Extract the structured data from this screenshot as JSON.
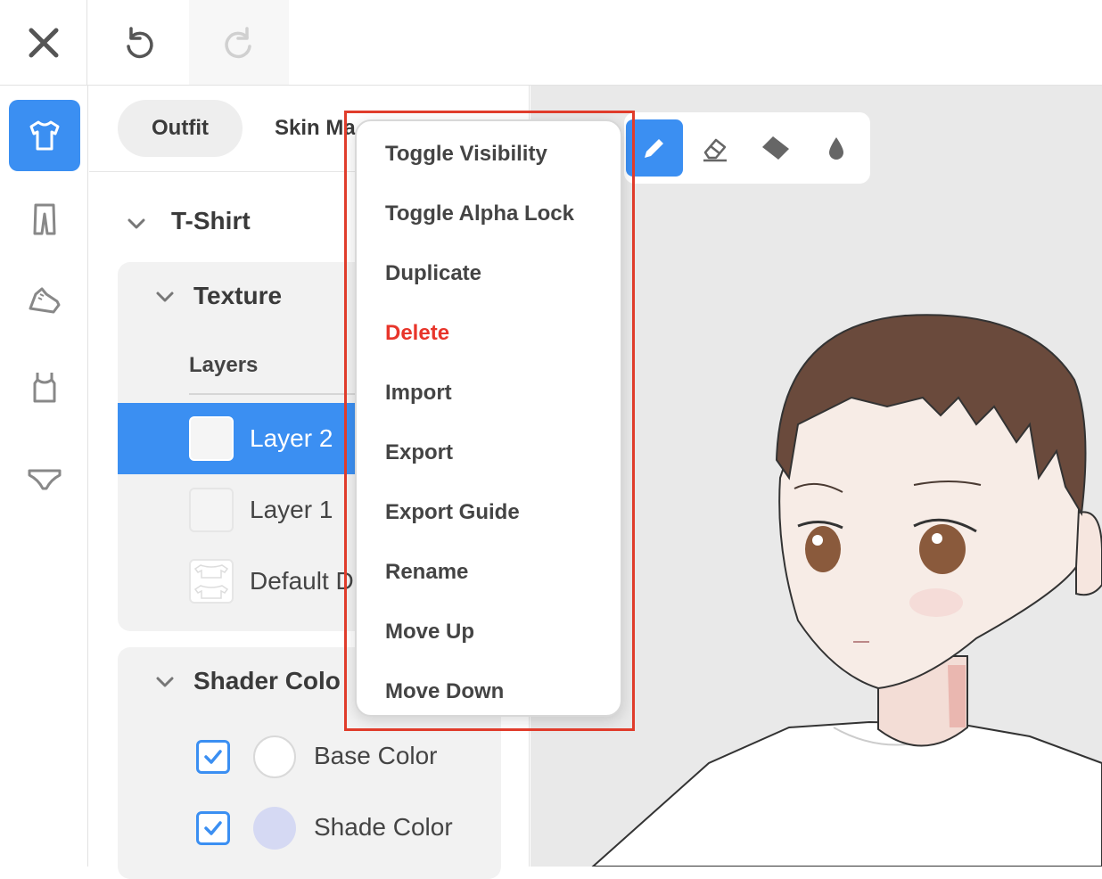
{
  "toolbar": {
    "close_icon": "close-icon",
    "undo_icon": "undo-icon",
    "redo_icon": "redo-icon"
  },
  "sidebar": {
    "items": [
      {
        "icon": "tshirt-icon",
        "active": true
      },
      {
        "icon": "pants-icon",
        "active": false
      },
      {
        "icon": "shoe-icon",
        "active": false
      },
      {
        "icon": "tank-top-icon",
        "active": false
      },
      {
        "icon": "underwear-icon",
        "active": false
      }
    ]
  },
  "panel": {
    "tabs": [
      {
        "label": "Outfit",
        "active": true
      },
      {
        "label": "Skin Ma",
        "active": false
      }
    ],
    "item_title": "T-Shirt",
    "texture": {
      "title": "Texture",
      "layers_label": "Layers",
      "layers": [
        {
          "label": "Layer 2",
          "selected": true
        },
        {
          "label": "Layer 1",
          "selected": false
        },
        {
          "label": "Default D",
          "selected": false
        }
      ]
    },
    "shader": {
      "title": "Shader Colo",
      "colors": [
        {
          "label": "Base Color",
          "checked": true,
          "color": "#ffffff"
        },
        {
          "label": "Shade Color",
          "checked": true,
          "color": "#d5d9f3"
        }
      ]
    }
  },
  "viewport": {
    "tools": [
      {
        "icon": "pencil-icon",
        "active": true
      },
      {
        "icon": "eraser-icon",
        "active": false
      },
      {
        "icon": "fill-bucket-icon",
        "active": false
      },
      {
        "icon": "dropper-icon",
        "active": false
      }
    ]
  },
  "context_menu": {
    "items": [
      {
        "label": "Toggle Visibility"
      },
      {
        "label": "Toggle Alpha Lock"
      },
      {
        "label": "Duplicate"
      },
      {
        "label": "Delete",
        "danger": true
      },
      {
        "label": "Import"
      },
      {
        "label": "Export"
      },
      {
        "label": "Export Guide"
      },
      {
        "label": "Rename"
      },
      {
        "label": "Move Up"
      },
      {
        "label": "Move Down"
      }
    ]
  },
  "colors": {
    "accent": "#3b8ff2",
    "danger": "#e8352b",
    "highlight_box": "#e03c2b"
  }
}
